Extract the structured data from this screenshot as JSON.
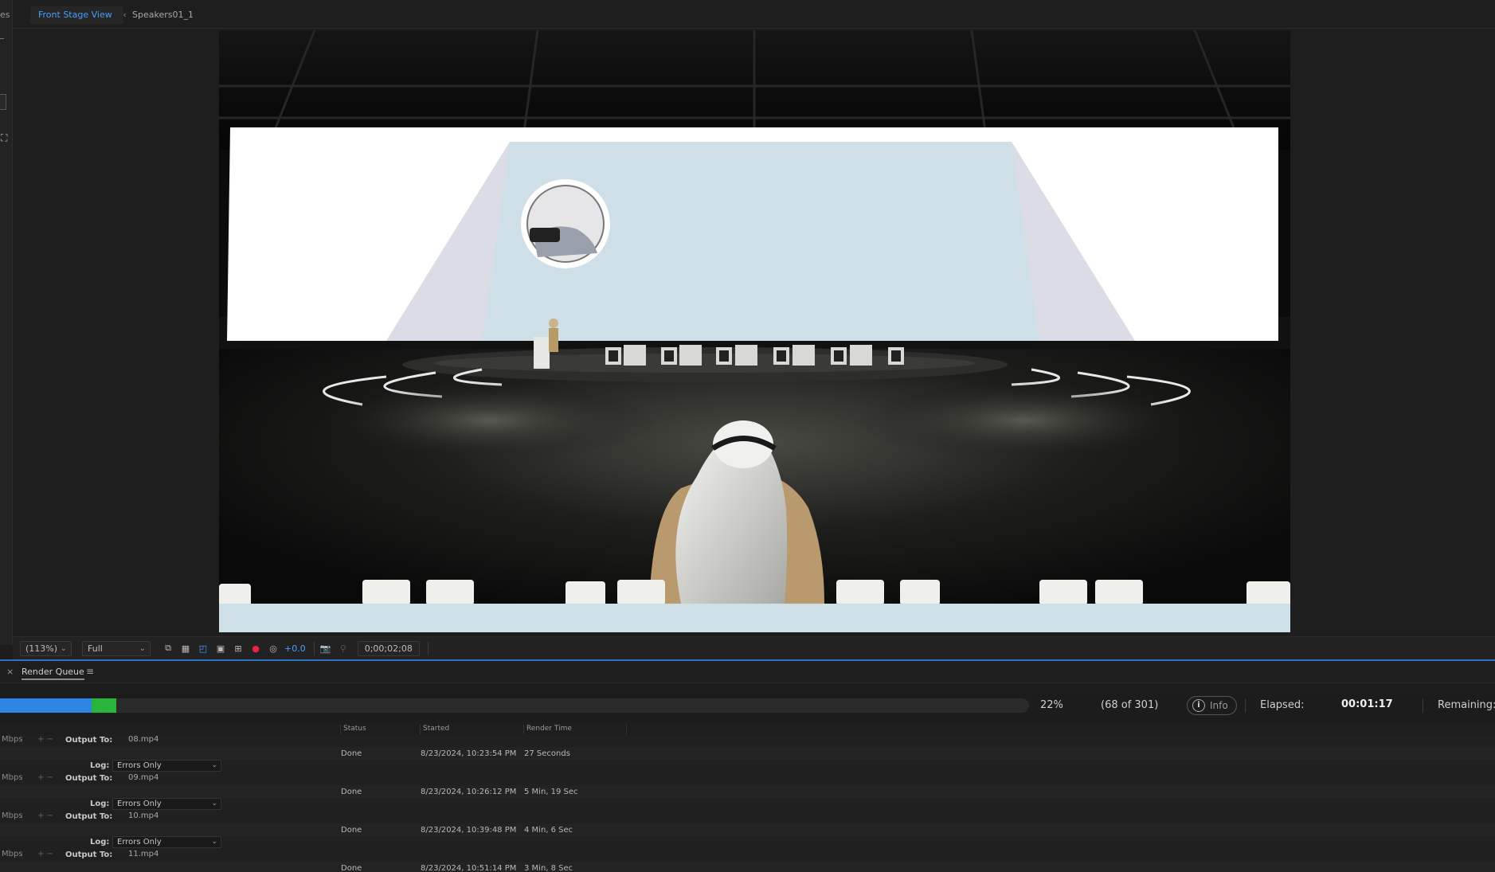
{
  "left_strip": {
    "cut_text": "es"
  },
  "viewer": {
    "tabs": [
      {
        "label": "Front Stage View",
        "active": true
      },
      {
        "label": "Speakers01_1",
        "active": false
      }
    ]
  },
  "toolbar": {
    "zoom": "(113%)",
    "resolution": "Full",
    "exposure": "+0.0",
    "timecode": "0;00;02;08"
  },
  "render_queue": {
    "close_symbol": "×",
    "title": "Render Queue",
    "menu_symbol": "≡",
    "progress": {
      "percent_label": "22%",
      "fraction": 0.2259,
      "frames_label": "(68 of 301)",
      "info_label": "Info",
      "elapsed_label": "Elapsed:",
      "elapsed_value": "00:01:17",
      "remaining_label": "Remaining:"
    },
    "columns": [
      "Status",
      "Started",
      "Render Time"
    ],
    "items": [
      {
        "file": "08.mp4",
        "status": "Done",
        "started": "8/23/2024, 10:23:54 PM",
        "render_time": "27 Seconds",
        "log": "Errors Only"
      },
      {
        "file": "09.mp4",
        "status": "Done",
        "started": "8/23/2024, 10:26:12 PM",
        "render_time": "5 Min, 19 Sec",
        "log": "Errors Only"
      },
      {
        "file": "10.mp4",
        "status": "Done",
        "started": "8/23/2024, 10:39:48 PM",
        "render_time": "4 Min, 6 Sec",
        "log": "Errors Only"
      },
      {
        "file": "11.mp4",
        "status": "Done",
        "started": "8/23/2024, 10:51:14 PM",
        "render_time": "3 Min, 8 Sec"
      }
    ],
    "labels": {
      "mbps": "Mbps",
      "output_to": "Output To:",
      "log": "Log:"
    }
  },
  "colors": {
    "accent_blue": "#2d86e6",
    "progress_green": "#28b53b",
    "tab_blue": "#4a9eff"
  }
}
